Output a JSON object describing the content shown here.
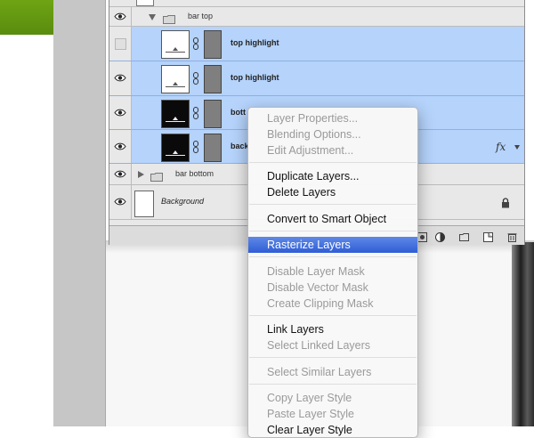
{
  "layers_panel": {
    "rows": [
      {
        "id": "bar-top-group",
        "name": "bar top",
        "type": "group",
        "expanded": true,
        "visible": true,
        "selected": false
      },
      {
        "id": "top-highlight-1",
        "name": "top highlight",
        "type": "layer",
        "visible": false,
        "selected": true,
        "thumb": "white"
      },
      {
        "id": "top-highlight-2",
        "name": "top highlight",
        "type": "layer",
        "visible": true,
        "selected": true,
        "thumb": "white"
      },
      {
        "id": "bottom-1",
        "name": "bott",
        "type": "layer",
        "visible": true,
        "selected": true,
        "thumb": "black"
      },
      {
        "id": "back-1",
        "name": "back",
        "type": "layer",
        "visible": true,
        "selected": true,
        "thumb": "black",
        "fx": "fx"
      },
      {
        "id": "bar-bottom-group",
        "name": "bar bottom",
        "type": "group",
        "expanded": false,
        "visible": true,
        "selected": false
      },
      {
        "id": "background",
        "name": "Background",
        "type": "background",
        "visible": true,
        "locked": true
      }
    ],
    "footer_icons": [
      "adjustment-layer-icon",
      "new-group-icon",
      "new-layer-icon",
      "trash-icon"
    ]
  },
  "context_menu": {
    "items": [
      {
        "label": "Layer Properties...",
        "enabled": false
      },
      {
        "label": "Blending Options...",
        "enabled": false
      },
      {
        "label": "Edit Adjustment...",
        "enabled": false
      },
      {
        "separator": true
      },
      {
        "label": "Duplicate Layers...",
        "enabled": true
      },
      {
        "label": "Delete Layers",
        "enabled": true
      },
      {
        "separator": true
      },
      {
        "label": "Convert to Smart Object",
        "enabled": true
      },
      {
        "separator": true
      },
      {
        "label": "Rasterize Layers",
        "enabled": true,
        "highlighted": true
      },
      {
        "separator": true
      },
      {
        "label": "Disable Layer Mask",
        "enabled": false
      },
      {
        "label": "Disable Vector Mask",
        "enabled": false
      },
      {
        "label": "Create Clipping Mask",
        "enabled": false
      },
      {
        "separator": true
      },
      {
        "label": "Link Layers",
        "enabled": true
      },
      {
        "label": "Select Linked Layers",
        "enabled": false
      },
      {
        "separator": true
      },
      {
        "label": "Select Similar Layers",
        "enabled": false
      },
      {
        "separator": true
      },
      {
        "label": "Copy Layer Style",
        "enabled": false
      },
      {
        "label": "Paste Layer Style",
        "enabled": false
      },
      {
        "label": "Clear Layer Style",
        "enabled": true
      }
    ]
  },
  "colors": {
    "selection": "#b5d3fb",
    "menu_highlight": "#3a68dc",
    "canvas_green": "#6ea414"
  }
}
